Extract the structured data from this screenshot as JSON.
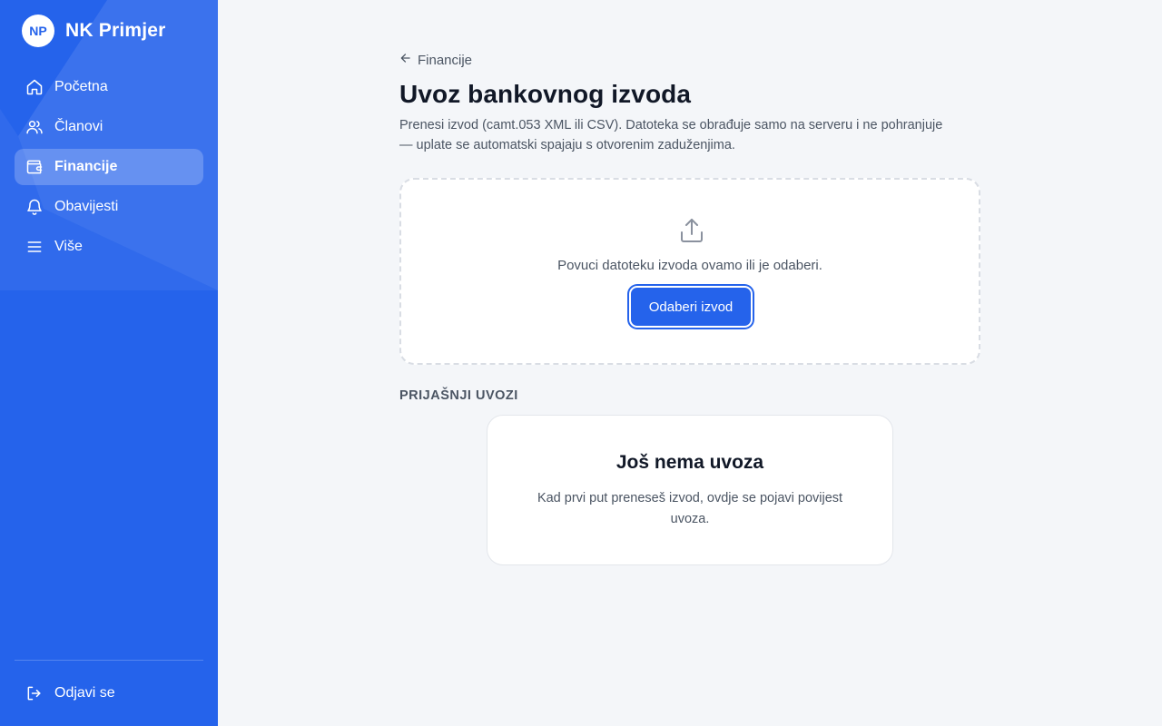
{
  "app": {
    "logo_initials": "NP",
    "name": "NK Primjer"
  },
  "sidebar": {
    "items": [
      {
        "label": "Početna",
        "icon": "home-icon",
        "active": false
      },
      {
        "label": "Članovi",
        "icon": "users-icon",
        "active": false
      },
      {
        "label": "Financije",
        "icon": "wallet-icon",
        "active": true
      },
      {
        "label": "Obavijesti",
        "icon": "bell-icon",
        "active": false
      },
      {
        "label": "Više",
        "icon": "menu-icon",
        "active": false
      }
    ],
    "logout_label": "Odjavi se"
  },
  "main": {
    "back_label": "Financije",
    "title": "Uvoz bankovnog izvoda",
    "description": "Prenesi izvod (camt.053 XML ili CSV). Datoteka se obrađuje samo na serveru i ne pohranjuje — uplate se automatski spajaju s otvorenim zaduženjima.",
    "dropzone": {
      "text": "Povuci datoteku izvoda ovamo ili je odaberi.",
      "button_label": "Odaberi izvod",
      "icon": "upload-icon"
    },
    "previous_imports": {
      "section_label": "PRIJAŠNJI UVOZI",
      "empty_title": "Još nema uvoza",
      "empty_description": "Kad prvi put preneseš izvod, ovdje se pojavi povijest uvoza."
    }
  },
  "colors": {
    "accent": "#2563eb",
    "background": "#f4f6f9",
    "text": "#111827"
  }
}
